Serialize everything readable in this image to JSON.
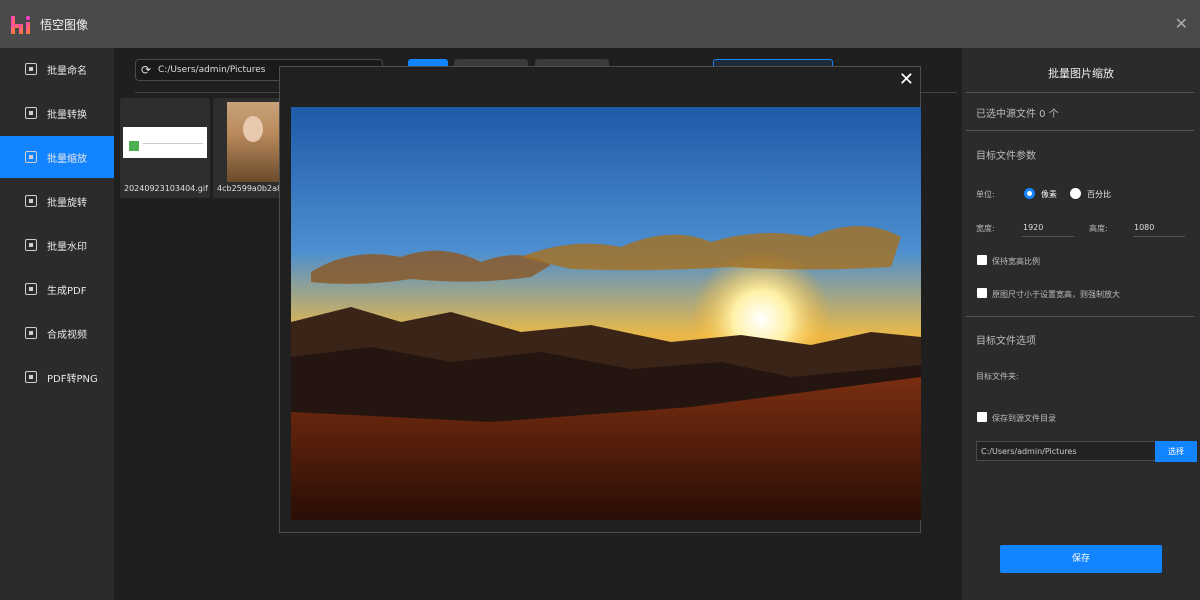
{
  "app": {
    "title": "悟空图像",
    "logo_text": "H"
  },
  "sidebar": {
    "items": [
      {
        "label": "批量命名"
      },
      {
        "label": "批量转换"
      },
      {
        "label": "批量缩放"
      },
      {
        "label": "批量旋转"
      },
      {
        "label": "批量水印"
      },
      {
        "label": "生成PDF"
      },
      {
        "label": "合成视频"
      },
      {
        "label": "PDF转PNG"
      }
    ],
    "active": "批量缩放"
  },
  "toolbar": {
    "path": "C:/Users/admin/Pictures"
  },
  "files": [
    {
      "name": "20240923103404.gif"
    },
    {
      "name": "4cb2599a0b2a89"
    }
  ],
  "preview": {
    "close_icon": "close-icon",
    "image": "sunset over mountains"
  },
  "panel": {
    "title": "批量图片缩放",
    "selected_count": "已选中源文件 0 个",
    "params_title": "目标文件参数",
    "unit_label": "单位:",
    "unit_pixel": "像素",
    "unit_percent": "百分比",
    "width_label": "宽度:",
    "width_value": "1920",
    "height_label": "高度:",
    "height_value": "1080",
    "keep_ratio": "保持宽高比例",
    "force_enlarge": "原图尺寸小于设置宽高，则强制放大",
    "options_title": "目标文件选项",
    "folder_label": "目标文件夹:",
    "save_to_source": "保存到源文件目录",
    "folder_path": "C:/Users/admin/Pictures",
    "choose_button": "选择",
    "save_button": "保存"
  },
  "colors": {
    "accent": "#1284ff",
    "sidebar_bg": "#2b2b2b",
    "titlebar_bg": "#4a4a4a"
  }
}
